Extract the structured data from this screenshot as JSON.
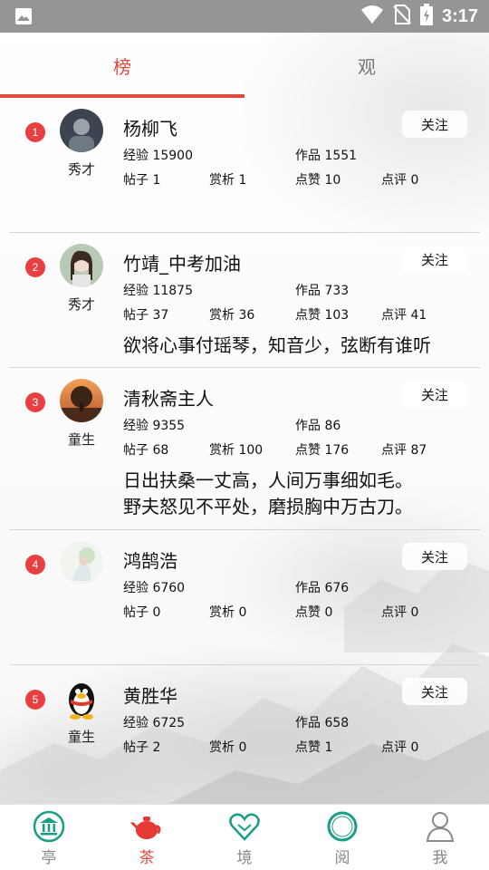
{
  "status_bar": {
    "time": "3:17"
  },
  "tabs": [
    {
      "label": "榜",
      "active": true
    },
    {
      "label": "观",
      "active": false
    }
  ],
  "labels": {
    "experience": "经验",
    "works": "作品",
    "posts": "帖子",
    "appreciation": "赏析",
    "likes": "点赞",
    "comments": "点评",
    "follow": "关注"
  },
  "users": [
    {
      "rank": "1",
      "name": "杨柳飞",
      "level": "秀才",
      "experience": "15900",
      "works": "1551",
      "posts": "1",
      "appreciation": "1",
      "likes": "10",
      "comments": "0",
      "signature": []
    },
    {
      "rank": "2",
      "name": "竹靖_中考加油",
      "level": "秀才",
      "experience": "11875",
      "works": "733",
      "posts": "37",
      "appreciation": "36",
      "likes": "103",
      "comments": "41",
      "signature": [
        "欲将心事付瑶琴，知音少，弦断有谁听"
      ]
    },
    {
      "rank": "3",
      "name": "清秋斋主人",
      "level": "童生",
      "experience": "9355",
      "works": "86",
      "posts": "68",
      "appreciation": "100",
      "likes": "176",
      "comments": "87",
      "signature": [
        "日出扶桑一丈高，人间万事细如毛。",
        "野夫怒见不平处，磨损胸中万古刀。"
      ]
    },
    {
      "rank": "4",
      "name": "鸿鹄浩",
      "level": "",
      "experience": "6760",
      "works": "676",
      "posts": "0",
      "appreciation": "0",
      "likes": "0",
      "comments": "0",
      "signature": []
    },
    {
      "rank": "5",
      "name": "黄胜华",
      "level": "童生",
      "experience": "6725",
      "works": "658",
      "posts": "2",
      "appreciation": "0",
      "likes": "1",
      "comments": "0",
      "signature": []
    }
  ],
  "bottom_nav": [
    {
      "label": "亭",
      "icon": "pavilion-icon",
      "active": false
    },
    {
      "label": "茶",
      "icon": "teapot-icon",
      "active": true
    },
    {
      "label": "境",
      "icon": "heart-icon",
      "active": false
    },
    {
      "label": "阅",
      "icon": "ring-icon",
      "active": false
    },
    {
      "label": "我",
      "icon": "person-icon",
      "active": false
    }
  ],
  "colors": {
    "accent": "#e0483e",
    "rank_badge": "#e84040",
    "nav_icon_teal": "#1a9e86",
    "status_bar": "#959595"
  }
}
